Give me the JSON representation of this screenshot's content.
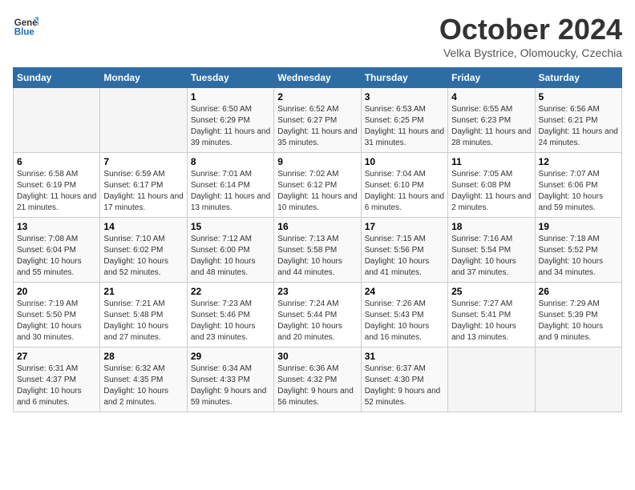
{
  "header": {
    "logo_line1": "General",
    "logo_line2": "Blue",
    "month": "October 2024",
    "location": "Velka Bystrice, Olomoucky, Czechia"
  },
  "weekdays": [
    "Sunday",
    "Monday",
    "Tuesday",
    "Wednesday",
    "Thursday",
    "Friday",
    "Saturday"
  ],
  "weeks": [
    [
      {
        "day": "",
        "info": ""
      },
      {
        "day": "",
        "info": ""
      },
      {
        "day": "1",
        "info": "Sunrise: 6:50 AM\nSunset: 6:29 PM\nDaylight: 11 hours and 39 minutes."
      },
      {
        "day": "2",
        "info": "Sunrise: 6:52 AM\nSunset: 6:27 PM\nDaylight: 11 hours and 35 minutes."
      },
      {
        "day": "3",
        "info": "Sunrise: 6:53 AM\nSunset: 6:25 PM\nDaylight: 11 hours and 31 minutes."
      },
      {
        "day": "4",
        "info": "Sunrise: 6:55 AM\nSunset: 6:23 PM\nDaylight: 11 hours and 28 minutes."
      },
      {
        "day": "5",
        "info": "Sunrise: 6:56 AM\nSunset: 6:21 PM\nDaylight: 11 hours and 24 minutes."
      }
    ],
    [
      {
        "day": "6",
        "info": "Sunrise: 6:58 AM\nSunset: 6:19 PM\nDaylight: 11 hours and 21 minutes."
      },
      {
        "day": "7",
        "info": "Sunrise: 6:59 AM\nSunset: 6:17 PM\nDaylight: 11 hours and 17 minutes."
      },
      {
        "day": "8",
        "info": "Sunrise: 7:01 AM\nSunset: 6:14 PM\nDaylight: 11 hours and 13 minutes."
      },
      {
        "day": "9",
        "info": "Sunrise: 7:02 AM\nSunset: 6:12 PM\nDaylight: 11 hours and 10 minutes."
      },
      {
        "day": "10",
        "info": "Sunrise: 7:04 AM\nSunset: 6:10 PM\nDaylight: 11 hours and 6 minutes."
      },
      {
        "day": "11",
        "info": "Sunrise: 7:05 AM\nSunset: 6:08 PM\nDaylight: 11 hours and 2 minutes."
      },
      {
        "day": "12",
        "info": "Sunrise: 7:07 AM\nSunset: 6:06 PM\nDaylight: 10 hours and 59 minutes."
      }
    ],
    [
      {
        "day": "13",
        "info": "Sunrise: 7:08 AM\nSunset: 6:04 PM\nDaylight: 10 hours and 55 minutes."
      },
      {
        "day": "14",
        "info": "Sunrise: 7:10 AM\nSunset: 6:02 PM\nDaylight: 10 hours and 52 minutes."
      },
      {
        "day": "15",
        "info": "Sunrise: 7:12 AM\nSunset: 6:00 PM\nDaylight: 10 hours and 48 minutes."
      },
      {
        "day": "16",
        "info": "Sunrise: 7:13 AM\nSunset: 5:58 PM\nDaylight: 10 hours and 44 minutes."
      },
      {
        "day": "17",
        "info": "Sunrise: 7:15 AM\nSunset: 5:56 PM\nDaylight: 10 hours and 41 minutes."
      },
      {
        "day": "18",
        "info": "Sunrise: 7:16 AM\nSunset: 5:54 PM\nDaylight: 10 hours and 37 minutes."
      },
      {
        "day": "19",
        "info": "Sunrise: 7:18 AM\nSunset: 5:52 PM\nDaylight: 10 hours and 34 minutes."
      }
    ],
    [
      {
        "day": "20",
        "info": "Sunrise: 7:19 AM\nSunset: 5:50 PM\nDaylight: 10 hours and 30 minutes."
      },
      {
        "day": "21",
        "info": "Sunrise: 7:21 AM\nSunset: 5:48 PM\nDaylight: 10 hours and 27 minutes."
      },
      {
        "day": "22",
        "info": "Sunrise: 7:23 AM\nSunset: 5:46 PM\nDaylight: 10 hours and 23 minutes."
      },
      {
        "day": "23",
        "info": "Sunrise: 7:24 AM\nSunset: 5:44 PM\nDaylight: 10 hours and 20 minutes."
      },
      {
        "day": "24",
        "info": "Sunrise: 7:26 AM\nSunset: 5:43 PM\nDaylight: 10 hours and 16 minutes."
      },
      {
        "day": "25",
        "info": "Sunrise: 7:27 AM\nSunset: 5:41 PM\nDaylight: 10 hours and 13 minutes."
      },
      {
        "day": "26",
        "info": "Sunrise: 7:29 AM\nSunset: 5:39 PM\nDaylight: 10 hours and 9 minutes."
      }
    ],
    [
      {
        "day": "27",
        "info": "Sunrise: 6:31 AM\nSunset: 4:37 PM\nDaylight: 10 hours and 6 minutes."
      },
      {
        "day": "28",
        "info": "Sunrise: 6:32 AM\nSunset: 4:35 PM\nDaylight: 10 hours and 2 minutes."
      },
      {
        "day": "29",
        "info": "Sunrise: 6:34 AM\nSunset: 4:33 PM\nDaylight: 9 hours and 59 minutes."
      },
      {
        "day": "30",
        "info": "Sunrise: 6:36 AM\nSunset: 4:32 PM\nDaylight: 9 hours and 56 minutes."
      },
      {
        "day": "31",
        "info": "Sunrise: 6:37 AM\nSunset: 4:30 PM\nDaylight: 9 hours and 52 minutes."
      },
      {
        "day": "",
        "info": ""
      },
      {
        "day": "",
        "info": ""
      }
    ]
  ]
}
